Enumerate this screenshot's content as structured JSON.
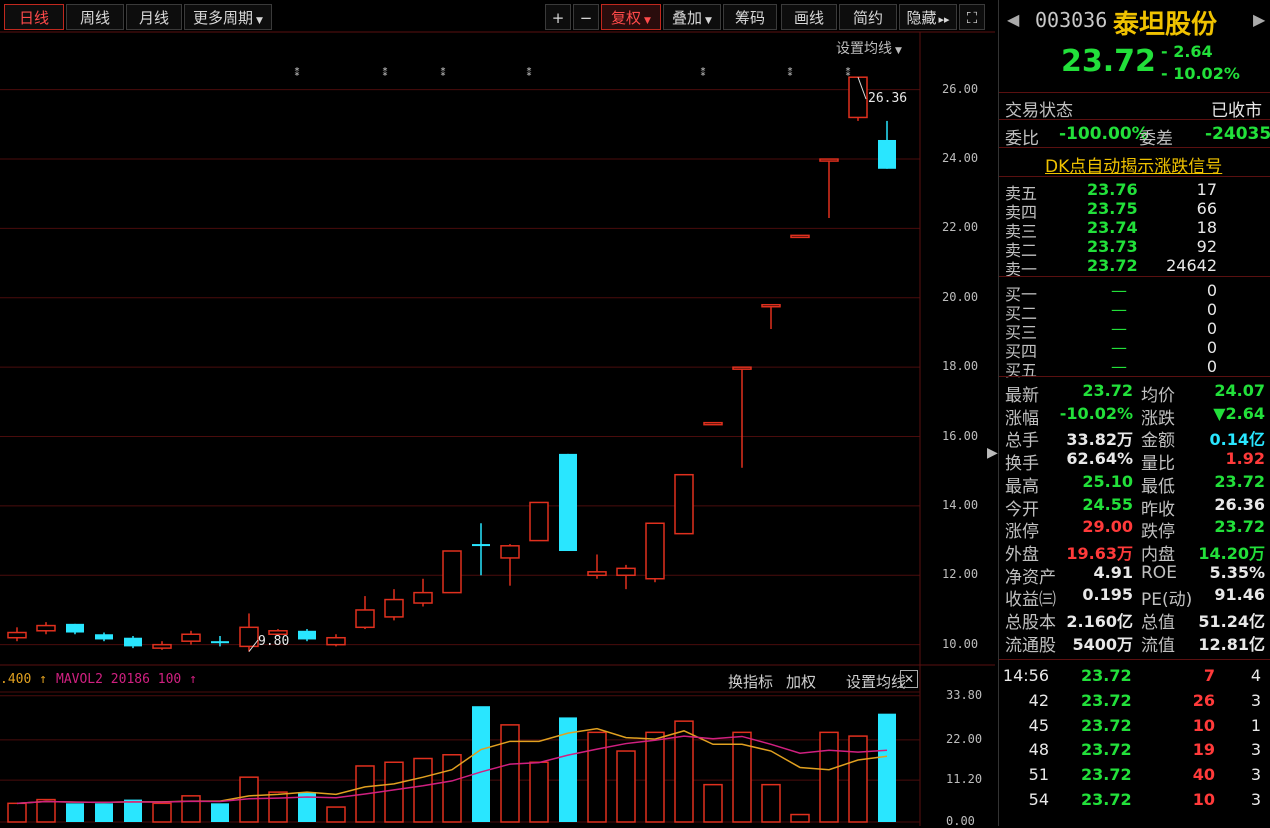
{
  "toolbar": {
    "day": "日线",
    "week": "周线",
    "month": "月线",
    "more_periods": "更多周期",
    "plus": "+",
    "minus": "−",
    "adjust": "复权",
    "overlay": "叠加",
    "chips": "筹码",
    "draw": "画线",
    "brief": "简约",
    "hide": "隐藏",
    "fullscreen": "⛶",
    "set_ma": "设置均线"
  },
  "price_axis": [
    "26.00",
    "24.00",
    "22.00",
    "20.00",
    "18.00",
    "16.00",
    "14.00",
    "12.00",
    "10.00"
  ],
  "price_annotations": {
    "high_label": "26.36",
    "low_label": "9.80"
  },
  "vol_header": {
    "left": ".400",
    "indicator": "MAVOL2",
    "params": "20186",
    "value": "100",
    "links": [
      "换指标",
      "加权",
      "设置均线"
    ]
  },
  "vol_axis": [
    "33.80",
    "22.00",
    "11.20",
    "0.00"
  ],
  "chart_data": {
    "type": "candlestick",
    "candles": [
      {
        "o": 10.2,
        "c": 10.35,
        "h": 10.5,
        "l": 10.1
      },
      {
        "o": 10.4,
        "c": 10.55,
        "h": 10.65,
        "l": 10.3
      },
      {
        "o": 10.6,
        "c": 10.35,
        "h": 10.6,
        "l": 10.3
      },
      {
        "o": 10.3,
        "c": 10.15,
        "h": 10.35,
        "l": 10.1
      },
      {
        "o": 10.2,
        "c": 9.95,
        "h": 10.25,
        "l": 9.9
      },
      {
        "o": 9.9,
        "c": 10.0,
        "h": 10.1,
        "l": 9.85
      },
      {
        "o": 10.1,
        "c": 10.3,
        "h": 10.4,
        "l": 10.0
      },
      {
        "o": 10.1,
        "c": 10.05,
        "h": 10.25,
        "l": 9.95
      },
      {
        "o": 9.95,
        "c": 10.5,
        "h": 10.9,
        "l": 9.8
      },
      {
        "o": 10.3,
        "c": 10.4,
        "h": 10.45,
        "l": 10.25
      },
      {
        "o": 10.4,
        "c": 10.15,
        "h": 10.45,
        "l": 10.1
      },
      {
        "o": 10.0,
        "c": 10.2,
        "h": 10.3,
        "l": 9.95
      },
      {
        "o": 10.5,
        "c": 11.0,
        "h": 11.4,
        "l": 10.45
      },
      {
        "o": 10.8,
        "c": 11.3,
        "h": 11.6,
        "l": 10.7
      },
      {
        "o": 11.2,
        "c": 11.5,
        "h": 11.9,
        "l": 11.1
      },
      {
        "o": 11.5,
        "c": 12.7,
        "h": 12.7,
        "l": 11.5
      },
      {
        "o": 12.9,
        "c": 12.85,
        "h": 13.5,
        "l": 12.0
      },
      {
        "o": 12.5,
        "c": 12.85,
        "h": 12.9,
        "l": 11.7
      },
      {
        "o": 13.0,
        "c": 14.1,
        "h": 14.1,
        "l": 13.0
      },
      {
        "o": 15.5,
        "c": 12.7,
        "h": 15.5,
        "l": 12.7
      },
      {
        "o": 12.0,
        "c": 12.1,
        "h": 12.6,
        "l": 11.9
      },
      {
        "o": 12.0,
        "c": 12.2,
        "h": 12.3,
        "l": 11.6
      },
      {
        "o": 11.9,
        "c": 13.5,
        "h": 13.5,
        "l": 11.8
      },
      {
        "o": 13.2,
        "c": 14.9,
        "h": 14.9,
        "l": 13.2
      },
      {
        "o": 16.4,
        "c": 16.4,
        "h": 16.4,
        "l": 16.4
      },
      {
        "o": 18.0,
        "c": 18.0,
        "h": 18.0,
        "l": 15.1
      },
      {
        "o": 19.8,
        "c": 19.8,
        "h": 19.8,
        "l": 19.1
      },
      {
        "o": 21.8,
        "c": 21.8,
        "h": 21.8,
        "l": 21.8
      },
      {
        "o": 24.0,
        "c": 24.0,
        "h": 24.0,
        "l": 22.3
      },
      {
        "o": 25.2,
        "c": 26.36,
        "h": 26.36,
        "l": 25.1
      },
      {
        "o": 24.55,
        "c": 23.72,
        "h": 25.1,
        "l": 23.72
      }
    ],
    "volume": [
      5,
      6,
      5,
      5,
      6,
      5,
      7,
      5,
      12,
      8,
      8,
      4,
      15,
      16,
      17,
      18,
      31,
      26,
      16,
      28,
      24,
      19,
      24,
      27,
      10,
      24,
      10,
      2,
      24,
      23,
      29
    ],
    "ylim": [
      9.5,
      27.0
    ],
    "vol_ylim": [
      0,
      34
    ]
  },
  "quote": {
    "code": "003036",
    "name": "泰坦股份",
    "price": "23.72",
    "change": "- 2.64",
    "change_pct": "- 10.02%",
    "trade_status_label": "交易状态",
    "trade_status": "已收市",
    "weibi_label": "委比",
    "weibi": "-100.00%",
    "weicha_label": "委差",
    "weicha": "-24035",
    "banner": "DK点自动揭示涨跌信号"
  },
  "asks": [
    {
      "label": "卖五",
      "price": "23.76",
      "vol": "17"
    },
    {
      "label": "卖四",
      "price": "23.75",
      "vol": "66"
    },
    {
      "label": "卖三",
      "price": "23.74",
      "vol": "18"
    },
    {
      "label": "卖二",
      "price": "23.73",
      "vol": "92"
    },
    {
      "label": "卖一",
      "price": "23.72",
      "vol": "24642"
    }
  ],
  "bids": [
    {
      "label": "买一",
      "price": "—",
      "vol": "0"
    },
    {
      "label": "买二",
      "price": "—",
      "vol": "0"
    },
    {
      "label": "买三",
      "price": "—",
      "vol": "0"
    },
    {
      "label": "买四",
      "price": "—",
      "vol": "0"
    },
    {
      "label": "买五",
      "price": "—",
      "vol": "0"
    }
  ],
  "stats": [
    {
      "l1": "最新",
      "v1": "23.72",
      "c1": "green",
      "l2": "均价",
      "v2": "24.07",
      "c2": "green"
    },
    {
      "l1": "涨幅",
      "v1": "-10.02%",
      "c1": "green",
      "l2": "涨跌",
      "v2": "▼2.64",
      "c2": "green"
    },
    {
      "l1": "总手",
      "v1": "33.82万",
      "c1": "white",
      "l2": "金额",
      "v2": "0.14亿",
      "c2": "cyan"
    },
    {
      "l1": "换手",
      "v1": "62.64%",
      "c1": "white",
      "l2": "量比",
      "v2": "1.92",
      "c2": "red"
    },
    {
      "l1": "最高",
      "v1": "25.10",
      "c1": "green",
      "l2": "最低",
      "v2": "23.72",
      "c2": "green"
    },
    {
      "l1": "今开",
      "v1": "24.55",
      "c1": "green",
      "l2": "昨收",
      "v2": "26.36",
      "c2": "white"
    },
    {
      "l1": "涨停",
      "v1": "29.00",
      "c1": "red",
      "l2": "跌停",
      "v2": "23.72",
      "c2": "green"
    },
    {
      "l1": "外盘",
      "v1": "19.63万",
      "c1": "red",
      "l2": "内盘",
      "v2": "14.20万",
      "c2": "green"
    },
    {
      "l1": "净资产",
      "v1": "4.91",
      "c1": "white",
      "l2": "ROE",
      "v2": "5.35%",
      "c2": "white"
    },
    {
      "l1": "收益㈢",
      "v1": "0.195",
      "c1": "white",
      "l2": "PE(动)",
      "v2": "91.46",
      "c2": "white"
    },
    {
      "l1": "总股本",
      "v1": "2.160亿",
      "c1": "white",
      "l2": "总值",
      "v2": "51.24亿",
      "c2": "white"
    },
    {
      "l1": "流通股",
      "v1": "5400万",
      "c1": "white",
      "l2": "流值",
      "v2": "12.81亿",
      "c2": "white"
    }
  ],
  "ticks": [
    {
      "time": "14:56",
      "price": "23.72",
      "vol": "7",
      "n": "4"
    },
    {
      "time": "42",
      "price": "23.72",
      "vol": "26",
      "n": "3"
    },
    {
      "time": "45",
      "price": "23.72",
      "vol": "10",
      "n": "1"
    },
    {
      "time": "48",
      "price": "23.72",
      "vol": "19",
      "n": "3"
    },
    {
      "time": "51",
      "price": "23.72",
      "vol": "40",
      "n": "3"
    },
    {
      "time": "54",
      "price": "23.72",
      "vol": "10",
      "n": "3"
    }
  ],
  "colors": {
    "up": "#e0301e",
    "down": "#29e6ff",
    "grid": "#4a0c0c",
    "ma1": "#e0a020",
    "ma2": "#d02080"
  }
}
